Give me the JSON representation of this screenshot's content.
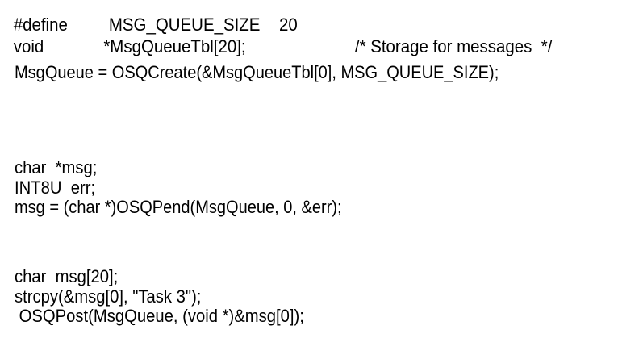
{
  "code_block_1": {
    "define_keyword": "#define",
    "define_name": "MSG_QUEUE_SIZE",
    "define_value": "20",
    "void_keyword": "void",
    "void_decl": "*MsgQueueTbl[20];",
    "comment": "/* Storage for messages  */",
    "create_stmt": "MsgQueue = OSQCreate(&MsgQueueTbl[0], MSG_QUEUE_SIZE);"
  },
  "code_block_2": {
    "lines": [
      "char  *msg;",
      "INT8U  err;",
      "msg = (char *)OSQPend(MsgQueue, 0, &err);"
    ]
  },
  "code_block_3": {
    "lines": [
      "char  msg[20];",
      "strcpy(&msg[0], \"Task 3\");",
      " OSQPost(MsgQueue, (void *)&msg[0]);"
    ]
  }
}
